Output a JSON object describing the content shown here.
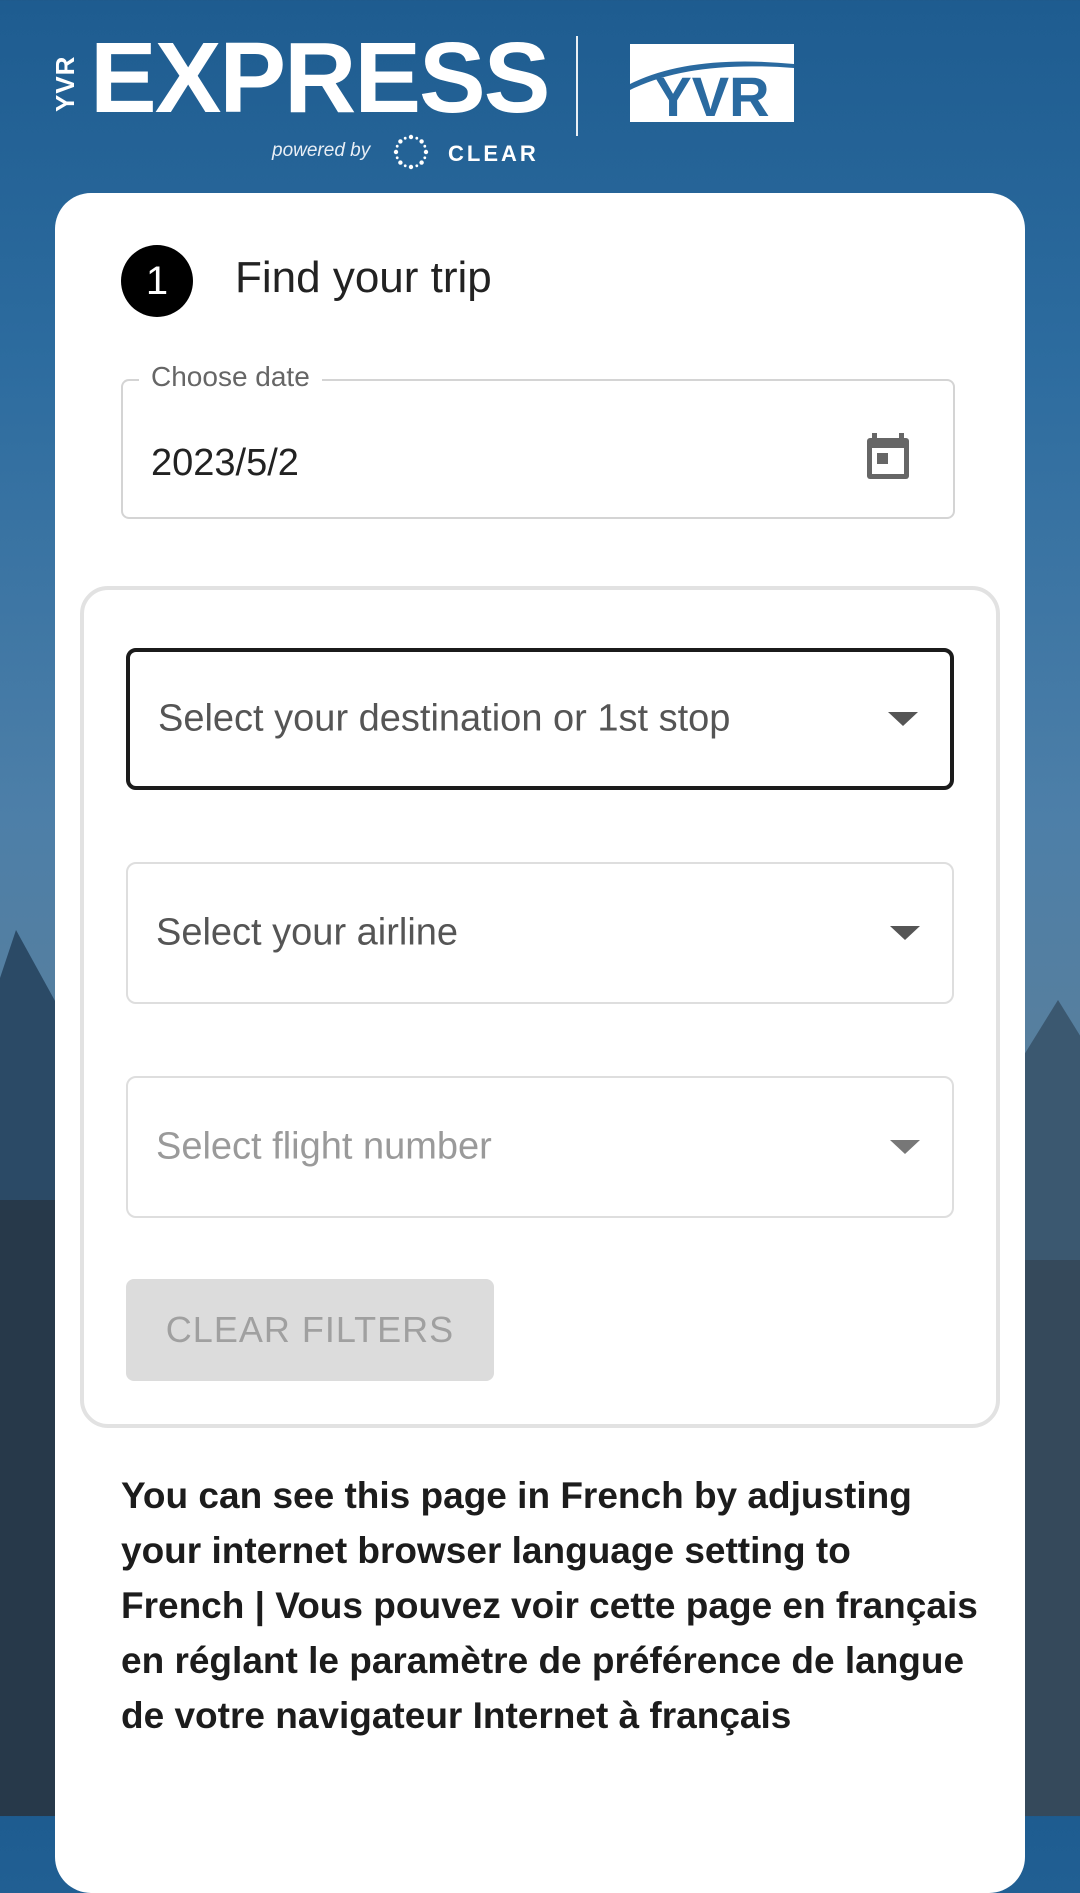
{
  "header": {
    "brand_vertical": "YVR",
    "brand_title": "EXPRESS",
    "powered_by": "powered by",
    "partner": "CLEAR",
    "logo_text": "YVR"
  },
  "step": {
    "number": "1",
    "title": "Find your trip"
  },
  "date": {
    "label": "Choose date",
    "value": "2023/5/2",
    "icon": "calendar-icon"
  },
  "filters": {
    "destination_placeholder": "Select your destination or 1st stop",
    "airline_placeholder": "Select your airline",
    "flight_placeholder": "Select flight number",
    "clear_label": "CLEAR FILTERS"
  },
  "language_note": "You can see this page in French by adjusting your internet browser language setting to French | Vous pouvez voir cette page en français en réglant le paramètre de préférence de langue de votre navigateur Internet à français",
  "colors": {
    "background_blue": "#1e5c90",
    "card": "#ffffff",
    "badge": "#000000",
    "button_disabled": "#dcdcdc"
  }
}
